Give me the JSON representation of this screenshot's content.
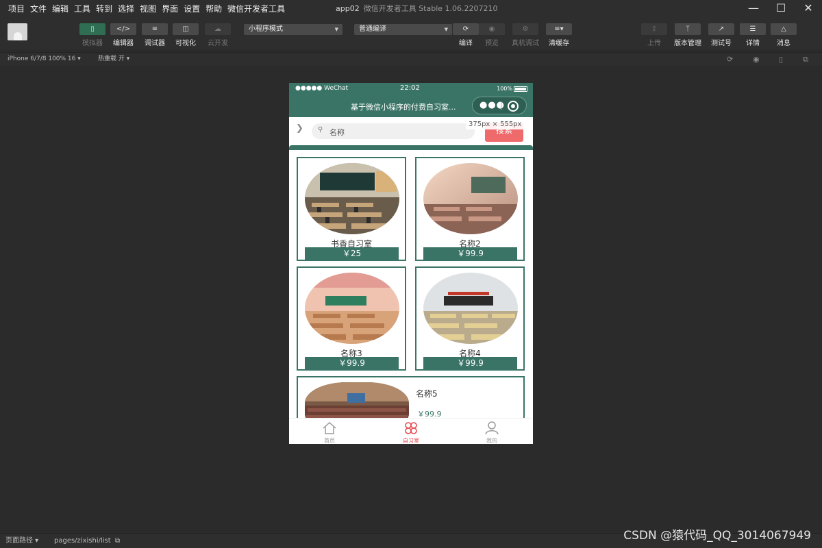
{
  "menu": [
    "项目",
    "文件",
    "编辑",
    "工具",
    "转到",
    "选择",
    "视图",
    "界面",
    "设置",
    "帮助",
    "微信开发者工具"
  ],
  "window": {
    "app": "app02",
    "subtitle": "微信开发者工具 Stable 1.06.2207210"
  },
  "toolbar": {
    "left": [
      {
        "label": "模拟器",
        "icon": "phone-icon",
        "state": "active"
      },
      {
        "label": "编辑器",
        "icon": "code-icon"
      },
      {
        "label": "调试器",
        "icon": "debug-icon"
      },
      {
        "label": "可视化",
        "icon": "layout-icon"
      },
      {
        "label": "云开发",
        "icon": "cloud-icon",
        "state": "disabled"
      }
    ],
    "mode_select": "小程序模式",
    "compile_select": "普通编译",
    "center": [
      {
        "label": "编译",
        "icon": "refresh-icon"
      },
      {
        "label": "预览",
        "icon": "eye-icon",
        "state": "disabled"
      },
      {
        "label": "真机调试",
        "icon": "bug-icon",
        "state": "disabled"
      },
      {
        "label": "清缓存",
        "icon": "layers-icon"
      }
    ],
    "right": [
      {
        "label": "上传",
        "icon": "upload-icon",
        "state": "disabled"
      },
      {
        "label": "版本管理",
        "icon": "branch-icon"
      },
      {
        "label": "测试号",
        "icon": "external-icon"
      },
      {
        "label": "详情",
        "icon": "menu-icon"
      },
      {
        "label": "消息",
        "icon": "bell-icon"
      }
    ]
  },
  "subbar": {
    "device": "iPhone 6/7/8 100% 16",
    "hot_reload": "热重载 开"
  },
  "phone": {
    "status": {
      "carrier": "●●●●● WeChat",
      "time": "22:02",
      "battery": "100%"
    },
    "nav_title": "基于微信小程序的付费自习室...",
    "size_tip": "375px × 555px",
    "search": {
      "placeholder": "名称",
      "button": "搜索"
    },
    "rooms": [
      {
        "name": "书香自习室",
        "price": "￥25"
      },
      {
        "name": "名称2",
        "price": "￥99.9"
      },
      {
        "name": "名称3",
        "price": "￥99.9"
      },
      {
        "name": "名称4",
        "price": "￥99.9"
      },
      {
        "name": "名称5",
        "price": "￥99.9"
      }
    ],
    "tabs": [
      {
        "label": "首页",
        "icon": "home-icon"
      },
      {
        "label": "自习室",
        "icon": "clover-icon",
        "active": true
      },
      {
        "label": "我的",
        "icon": "user-icon"
      }
    ]
  },
  "bottom": {
    "path_label": "页面路径",
    "path": "pages/zixishi/list"
  },
  "watermark": "CSDN @猿代码_QQ_3014067949",
  "colors": {
    "accent": "#3a7466",
    "search_button": "#ef6b6b",
    "active_tab": "#e5484d"
  }
}
